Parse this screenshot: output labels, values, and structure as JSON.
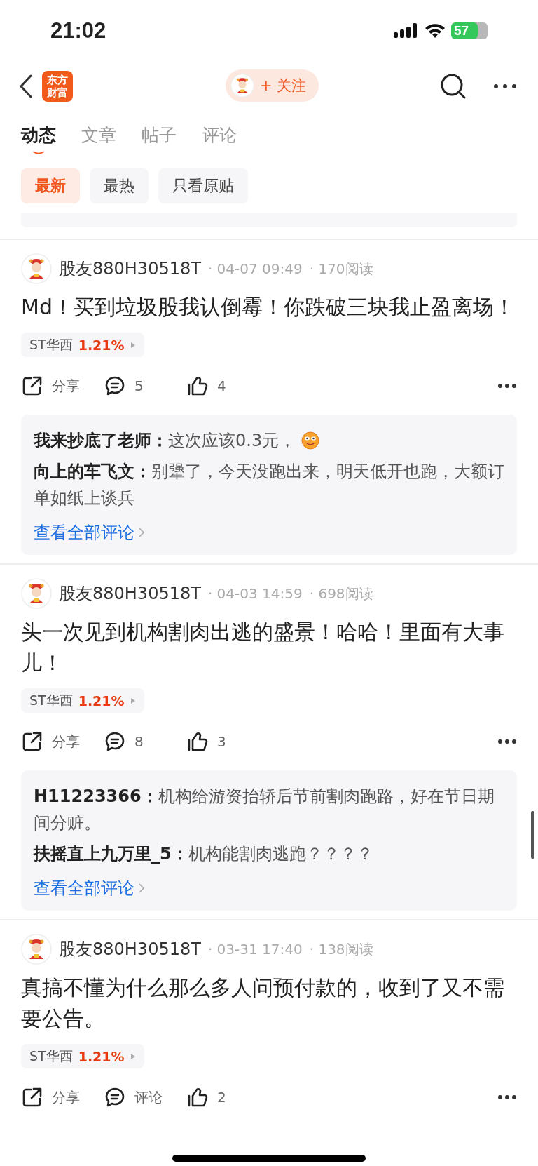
{
  "status_bar": {
    "time": "21:02",
    "battery": "57"
  },
  "nav": {
    "logo_lines": [
      "东方",
      "财富"
    ],
    "follow_button": "+ 关注"
  },
  "tabs": [
    {
      "label": "动态",
      "selected": true
    },
    {
      "label": "文章",
      "selected": false
    },
    {
      "label": "帖子",
      "selected": false
    },
    {
      "label": "评论",
      "selected": false
    }
  ],
  "filters": [
    {
      "label": "最新",
      "selected": true
    },
    {
      "label": "最热",
      "selected": false
    },
    {
      "label": "只看原贴",
      "selected": false
    }
  ],
  "posts": [
    {
      "author": "股友880H30518T",
      "time": "· 04-07 09:49",
      "reads": "· 170阅读",
      "text": "Md！买到垃圾股我认倒霉！你跌破三块我止盈离场！",
      "stock": {
        "name": "ST华西",
        "change": "1.21%"
      },
      "share": "分享",
      "comments": "5",
      "likes": "4",
      "replies": [
        {
          "author": "我来抄底了老师：",
          "text": "这次应该0.3元，",
          "emoji": true
        },
        {
          "author": "向上的车飞文：",
          "text": "别犟了，今天没跑出来，明天低开也跑，大额订单如纸上谈兵",
          "emoji": false
        }
      ],
      "view_all": "查看全部评论"
    },
    {
      "author": "股友880H30518T",
      "time": "· 04-03 14:59",
      "reads": "· 698阅读",
      "text": "头一次见到机构割肉出逃的盛景！哈哈！里面有大事儿！",
      "stock": {
        "name": "ST华西",
        "change": "1.21%"
      },
      "share": "分享",
      "comments": "8",
      "likes": "3",
      "replies": [
        {
          "author": "H11223366：",
          "text": "机构给游资抬轿后节前割肉跑路，好在节日期间分赃。",
          "emoji": false
        },
        {
          "author": "扶摇直上九万里_5：",
          "text": "机构能割肉逃跑？？？？",
          "emoji": false
        }
      ],
      "view_all": "查看全部评论"
    },
    {
      "author": "股友880H30518T",
      "time": "· 03-31 17:40",
      "reads": "· 138阅读",
      "text": "真搞不懂为什么那么多人问预付款的，收到了又不需要公告。",
      "stock": {
        "name": "ST华西",
        "change": "1.21%"
      },
      "share": "分享",
      "comments": "评论",
      "likes": "2"
    }
  ]
}
